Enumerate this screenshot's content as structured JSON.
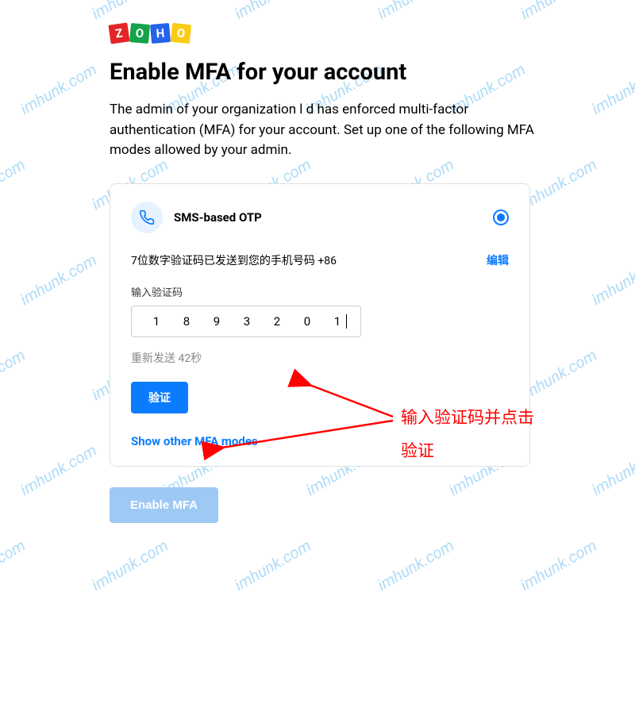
{
  "watermark": "imhunk.com",
  "logo": {
    "z": "Z",
    "o1": "O",
    "h": "H",
    "o2": "O"
  },
  "title": "Enable MFA for your account",
  "description_prefix": "The admin of your organization ",
  "description_masked": "l        d",
  "description_suffix": " has enforced multi-factor authentication (MFA) for your account. Set up one of the following MFA modes allowed by your admin.",
  "card": {
    "method_title": "SMS-based OTP",
    "sent_text": "7位数字验证码已发送到您的手机号码 +86",
    "edit_label": "编辑",
    "input_label": "输入验证码",
    "otp": [
      "1",
      "8",
      "9",
      "3",
      "2",
      "0",
      "1"
    ],
    "resend_text": "重新发送 42秒",
    "verify_label": "验证",
    "show_other_label": "Show other MFA modes"
  },
  "enable_label": "Enable MFA",
  "annotation": {
    "line1": "输入验证码并点击",
    "line2": "验证"
  }
}
